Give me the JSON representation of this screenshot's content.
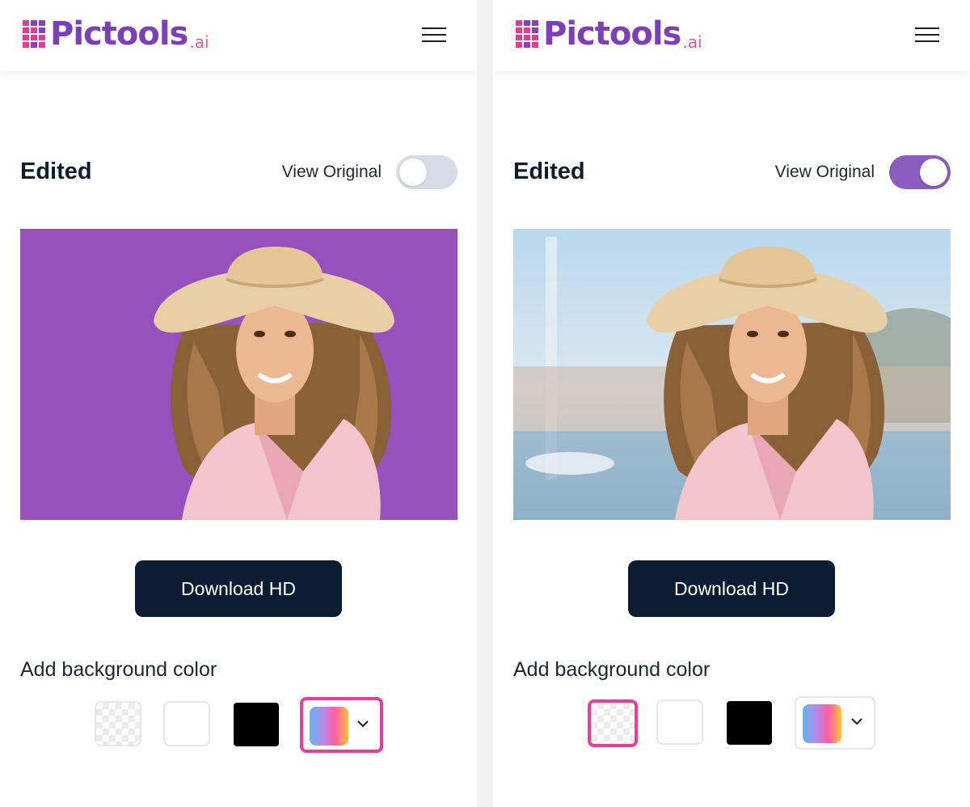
{
  "brand": {
    "name": "Pictools",
    "tld": ".ai"
  },
  "panels": [
    {
      "id": "left",
      "title": "Edited",
      "view_original_label": "View Original",
      "view_original_on": false,
      "background_shown": "purple",
      "download_label": "Download HD",
      "bg_color_label": "Add background color",
      "selected_swatch": "gradient-picker"
    },
    {
      "id": "right",
      "title": "Edited",
      "view_original_label": "View Original",
      "view_original_on": true,
      "background_shown": "original-photo",
      "download_label": "Download HD",
      "bg_color_label": "Add background color",
      "selected_swatch": "transparent"
    }
  ],
  "swatches": [
    "transparent",
    "white",
    "black",
    "gradient-picker"
  ],
  "colors": {
    "brand_purple": "#7d3fb8",
    "brand_pink": "#e5399c",
    "edited_background": "#9651bd",
    "toggle_on": "#8b5cc0",
    "toggle_off": "#d7dde6",
    "download_button": "#0b1d33",
    "selection_border": "#ea3c9c"
  },
  "icons": {
    "menu": "hamburger-icon",
    "dropdown": "chevron-down-icon"
  }
}
